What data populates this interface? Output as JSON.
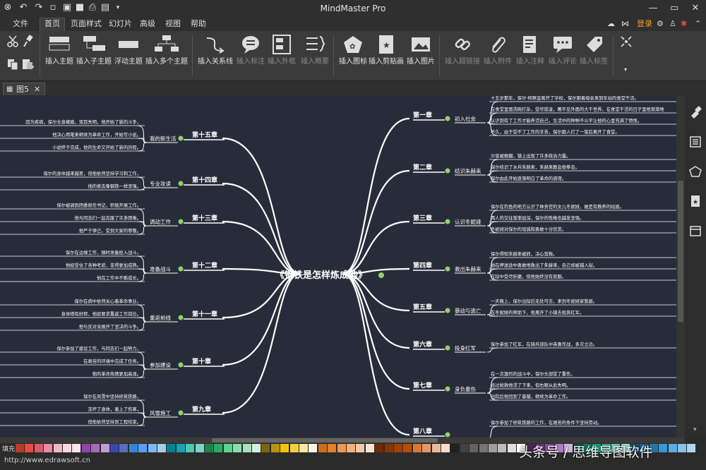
{
  "app": {
    "title": "MindMaster Pro"
  },
  "menu": {
    "items": [
      "文件",
      "首页",
      "页面样式",
      "幻灯片",
      "高级",
      "视图",
      "帮助"
    ],
    "active": "首页",
    "login": "登录"
  },
  "ribbon": {
    "group1": [
      "插入主题",
      "插入子主题",
      "浮动主题",
      "插入多个主题"
    ],
    "group2": [
      "插入关系线",
      "插入标注",
      "插入外框",
      "插入概要"
    ],
    "group3": [
      "插入图标",
      "插入剪贴画",
      "插入图片"
    ],
    "group4": [
      "插入超链接",
      "插入附件",
      "插入注释",
      "插入评论",
      "插入标签"
    ]
  },
  "tab": {
    "name": "图5"
  },
  "mindmap": {
    "central": "《钢铁是怎样炼成的》",
    "right_chapters": [
      {
        "chapter": "第一章",
        "topic": "初入社会",
        "notes": [
          "十五岁那年，保尔·柯察金离开了学校，保尔跟着母亲来到车站的食堂干活。",
          "在食堂里面洗碗打杂，受尽欺凌，瞧不见外面的大千世界，在食堂干活的日子里他渐渐地",
          "认识到有了工作才能养活自己，生活中的种种不公平让他的心里充满了愤恨。",
          "不久，由于受不了工作的辛苦，保尔跟人打了一架后离开了食堂。"
        ]
      },
      {
        "chapter": "第二章",
        "topic": "结识朱赫来",
        "notes": [
          "沙皇被推翻，镇上出现了许多政治力量。",
          "保尔结识了水兵朱赫来，朱赫来教会他拳击。",
          "保尔由此开始逐渐明白了革命的道理。"
        ]
      },
      {
        "chapter": "第三章",
        "topic": "认识冬妮娅",
        "notes": [
          "保尔在钓鱼的地方认识了林务官的女儿冬妮娅，她是有教养的姑娘。",
          "两人的交往渐渐加深，保尔的性格也越发坚强。",
          "冬妮娅对保尔的坦诚和勇敢十分欣赏。"
        ]
      },
      {
        "chapter": "第四章",
        "topic": "救出朱赫来",
        "notes": [
          "保尔得知朱赫来被抓，决心营救。",
          "他在押送途中勇敢地救出了朱赫来，自己却被捕入狱。",
          "在狱中受尽折磨，但他始终没有屈服。"
        ]
      },
      {
        "chapter": "第五章",
        "topic": "暴动与逃亡",
        "notes": [
          "一天晚上，保尔出狱后无处可去，来到冬妮娅家暂避。",
          "在冬妮娅的帮助下，他离开了小镇去投奔红军。"
        ]
      },
      {
        "chapter": "第六章",
        "topic": "投身红军",
        "notes": [
          "保尔参加了红军，在骑兵部队中英勇作战，多次立功。"
        ]
      },
      {
        "chapter": "第七章",
        "topic": "身负重伤",
        "notes": [
          "在一次激烈的战斗中，保尔头部受了重伤，",
          "经过抢救他活了下来，但右眼从此失明。",
          "出院后他回到了基辅，继续为革命工作。"
        ]
      },
      {
        "chapter": "第八章",
        "topic": "",
        "notes": [
          "保尔参加了修筑铁路的工作，在艰苦的条件下坚持劳动。"
        ]
      }
    ],
    "left_chapters": [
      {
        "chapter": "第十五章",
        "topic": "我的新生活",
        "notes": [
          "因为疾病，保尔全身瘫痪，双目失明，他开始了新的斗争，",
          "他决心用笔来继续为革命工作，开始写小说。",
          "小说终于完成，他的生命又开始了新的历程。"
        ]
      },
      {
        "chapter": "第十四章",
        "topic": "专业攻读",
        "notes": [
          "保尔的身体越来越差，但他依然坚持学习和工作，",
          "他的意志像钢铁一样坚强。"
        ]
      },
      {
        "chapter": "第十三章",
        "topic": "调动工作",
        "notes": [
          "保尔被调到团委担任书记，积极开展工作。",
          "他与同志们一起克服了许多困难。",
          "他严于律己，受到大家的尊敬。"
        ]
      },
      {
        "chapter": "第十二章",
        "topic": "准备战斗",
        "notes": [
          "保尔在边境工作，随时准备投入战斗。",
          "他经受住了各种考验，变得更加成熟。",
          "他在工作中不断成长。"
        ]
      },
      {
        "chapter": "第十一章",
        "topic": "重返前线",
        "notes": [
          "保尔在病中依然关心着革命事业。",
          "身体稍有好转，他就要求重返工作岗位。",
          "他与反对派展开了坚决的斗争。"
        ]
      },
      {
        "chapter": "第十章",
        "topic": "参加建设",
        "notes": [
          "保尔参加了建设工作，与同志们一起努力，",
          "在艰苦的环境中完成了任务。",
          "他的革命热情更加高涨。"
        ]
      },
      {
        "chapter": "第九章",
        "topic": "风雪施工",
        "notes": [
          "保尔在风雪中坚持修筑铁路，",
          "冻坏了身体，患上了伤寒，",
          "但他依然坚持到工程结束。"
        ]
      }
    ]
  },
  "statusbar": {
    "fill_label": "填充",
    "url": "http://www.edrawsoft.cn"
  },
  "watermark": "头条号 / 思维导图软件",
  "colors": {
    "canvas_bg": "#282c3a",
    "branch": "#ffffff",
    "node_dot": "#8ed36b"
  }
}
